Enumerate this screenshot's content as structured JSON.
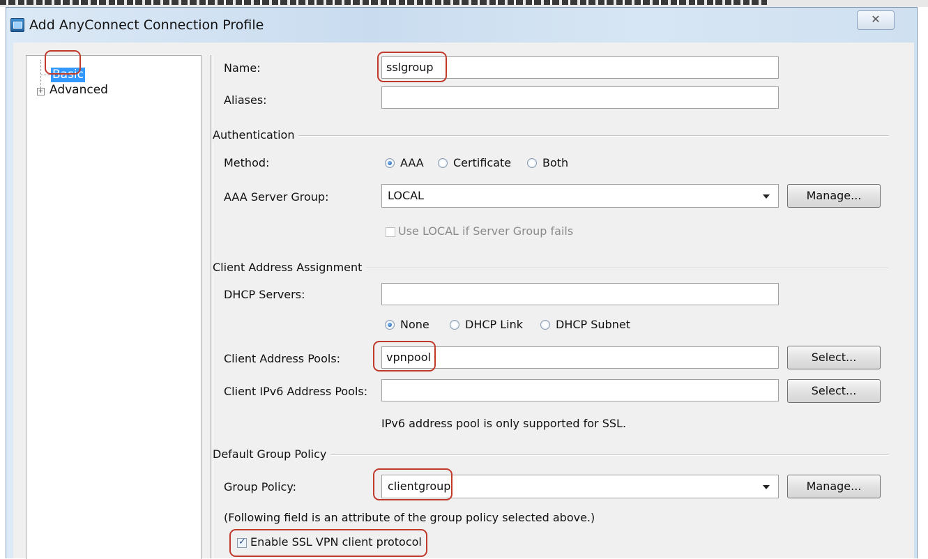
{
  "window": {
    "title": "Add AnyConnect Connection Profile",
    "close_glyph": "✕"
  },
  "tree": {
    "items": [
      {
        "label": "Basic",
        "selected": true
      },
      {
        "label": "Advanced",
        "expander": "+"
      }
    ]
  },
  "basic": {
    "name_label": "Name:",
    "name_value": "sslgroup",
    "aliases_label": "Aliases:",
    "aliases_value": ""
  },
  "authentication": {
    "group_label": "Authentication",
    "method_label": "Method:",
    "methods": [
      {
        "label": "AAA",
        "selected": true
      },
      {
        "label": "Certificate",
        "selected": false
      },
      {
        "label": "Both",
        "selected": false
      }
    ],
    "aaa_group_label": "AAA Server Group:",
    "aaa_group_value": "LOCAL",
    "manage_label": "Manage...",
    "fallback_label": "Use LOCAL if Server Group fails",
    "fallback_checked": false
  },
  "client_address": {
    "group_label": "Client Address Assignment",
    "dhcp_label": "DHCP Servers:",
    "dhcp_value": "",
    "dhcp_options": [
      {
        "label": "None",
        "selected": true
      },
      {
        "label": "DHCP Link",
        "selected": false
      },
      {
        "label": "DHCP Subnet",
        "selected": false
      }
    ],
    "pools_label": "Client Address Pools:",
    "pools_value": "vpnpool",
    "ipv6_label": "Client IPv6 Address Pools:",
    "ipv6_value": "",
    "select_label": "Select...",
    "ipv6_note": "IPv6 address pool is only supported for SSL."
  },
  "group_policy": {
    "group_label": "Default Group Policy",
    "policy_label": "Group Policy:",
    "policy_value": "clientgroup",
    "manage_label": "Manage...",
    "note": "(Following field is an attribute of the group policy selected above.)",
    "ssl_label": "Enable SSL VPN client protocol",
    "ssl_checked": true
  },
  "colors": {
    "highlight": "#c0392b",
    "selection": "#3399ff"
  }
}
